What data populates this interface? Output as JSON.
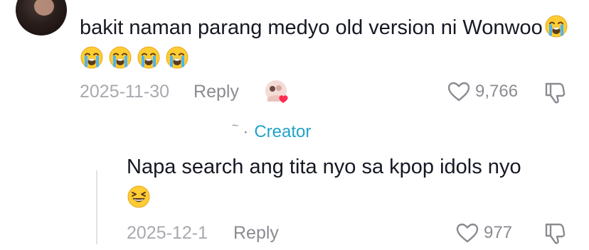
{
  "comment": {
    "text": "bakit naman parang medyo old version ni Wonwoo",
    "emojis": [
      "loudly-crying-face",
      "loudly-crying-face",
      "loudly-crying-face",
      "loudly-crying-face",
      "loudly-crying-face"
    ],
    "date": "2025-11-30",
    "reply_label": "Reply",
    "like_count": "9,766"
  },
  "reply": {
    "badge_dot": "·",
    "badge_label": "Creator",
    "badge_color": "#20a4c6",
    "text": "Napa search ang tita nyo sa kpop idols nyo",
    "emoji": "grinning-squinting-face",
    "date": "2025-12-1",
    "reply_label": "Reply",
    "like_count": "977"
  },
  "colors": {
    "text": "#161823",
    "muted": "#8a8b91",
    "accent": "#20a4c6",
    "heart": "#fe2c55"
  }
}
